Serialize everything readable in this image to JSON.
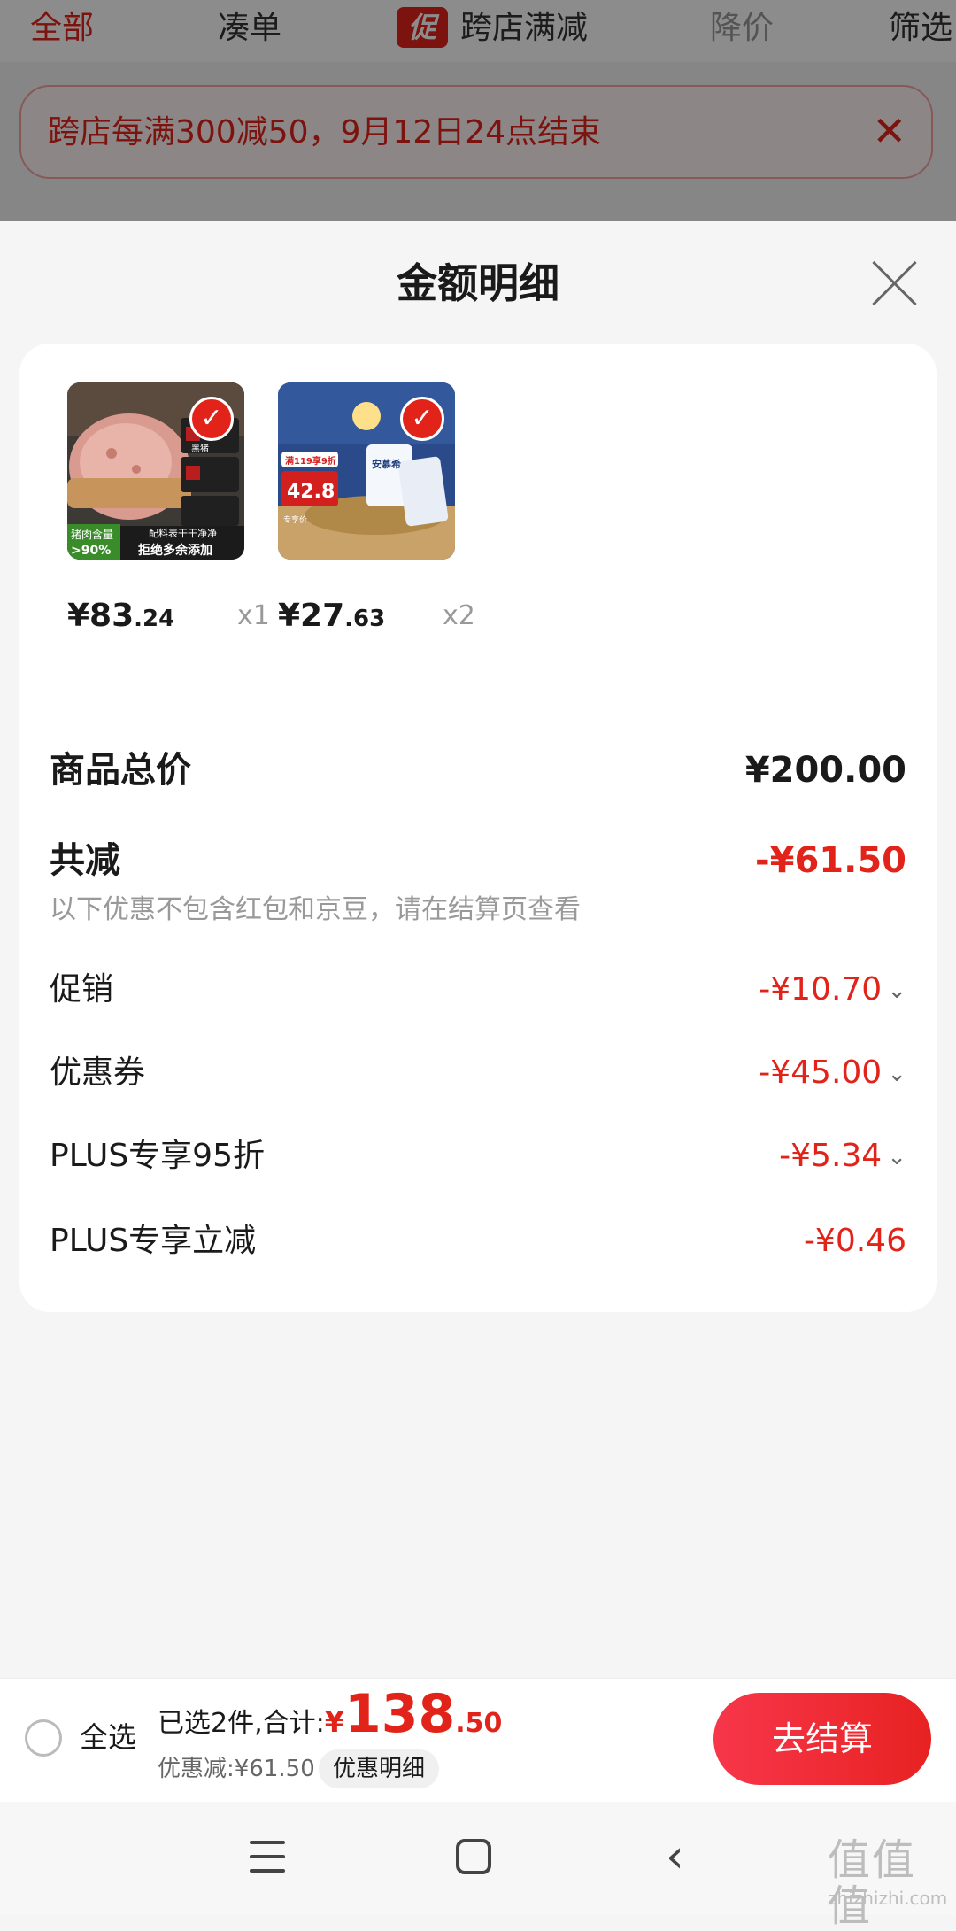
{
  "top_tabs": [
    {
      "label": "全部"
    },
    {
      "label": "凑单"
    },
    {
      "label": "跨店满减",
      "tag": "促"
    },
    {
      "label": "降价"
    },
    {
      "label": "筛选"
    }
  ],
  "promo_banner": {
    "text": "跨店每满300减50，9月12日24点结束",
    "close": "✕"
  },
  "sheet": {
    "title": "金额明细"
  },
  "products": [
    {
      "thumb_texts": [
        "猪肉含量",
        ">90%",
        "配料表干干净净",
        "拒绝多余添加",
        "黑猪"
      ],
      "price_int": "¥83",
      "price_dec": ".24",
      "qty": "x1"
    },
    {
      "thumb_texts": [
        "满119享9折",
        "42.8",
        "专享价",
        "安慕希"
      ],
      "price_int": "¥27",
      "price_dec": ".63",
      "qty": "x2"
    }
  ],
  "summary": {
    "total_label": "商品总价",
    "total_value": "¥200.00",
    "reduction_label": "共减",
    "reduction_value": "-¥61.50",
    "note": "以下优惠不包含红包和京豆，请在结算页查看",
    "items": [
      {
        "label": "促销",
        "value": "-¥10.70"
      },
      {
        "label": "优惠券",
        "value": "-¥45.00"
      },
      {
        "label": "PLUS专享95折",
        "value": "-¥5.34"
      },
      {
        "label": "PLUS专享立减",
        "value": "-¥0.46"
      }
    ]
  },
  "bottom_bar": {
    "select_all": "全选",
    "selected_text": "已选2件,合计:",
    "currency": "¥",
    "total_int": "138",
    "total_dec": ".50",
    "discount_text": "优惠减:¥61.50",
    "details_button": "优惠明细",
    "checkout_button": "去结算"
  },
  "sys_nav": {
    "back_glyph": "‹"
  },
  "watermark": {
    "icon_text": "值值值",
    "text": "zhizhizhi.com"
  },
  "colors": {
    "accent": "#e2231a",
    "muted": "#999999",
    "sheet_bg": "#f5f5f5"
  }
}
